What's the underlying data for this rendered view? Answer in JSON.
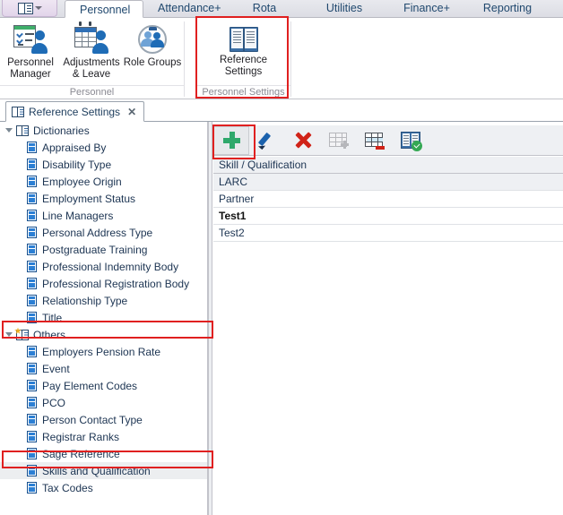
{
  "quick_access": {
    "icon": "book-list-icon",
    "caret": "chevron-down-icon"
  },
  "ribbon": {
    "tabs": [
      {
        "label": "Personnel",
        "active": true
      },
      {
        "label": "Attendance+",
        "active": false
      },
      {
        "label": "Rota",
        "active": false
      },
      {
        "label": "Utilities",
        "active": false
      },
      {
        "label": "Finance+",
        "active": false
      },
      {
        "label": "Reporting",
        "active": false
      }
    ],
    "groups": [
      {
        "name": "Personnel",
        "label": "Personnel",
        "buttons": [
          {
            "label_line1": "Personnel",
            "label_line2": "Manager",
            "icon": "personnel-manager-icon"
          },
          {
            "label_line1": "Adjustments",
            "label_line2": "& Leave",
            "icon": "adjustments-leave-icon"
          },
          {
            "label_line1": "Role Groups",
            "label_line2": "",
            "icon": "role-groups-icon"
          }
        ]
      },
      {
        "name": "Personnel Settings",
        "label": "Personnel Settings",
        "buttons": [
          {
            "label_line1": "Reference",
            "label_line2": "Settings",
            "icon": "reference-settings-icon"
          }
        ]
      }
    ]
  },
  "document_tab": {
    "label": "Reference Settings",
    "icon": "book-icon",
    "close": "✕"
  },
  "tree": {
    "nodes": [
      {
        "label": "Dictionaries",
        "level": 0,
        "icon": "book-icon",
        "expanded": true,
        "selected": false
      },
      {
        "label": "Appraised By",
        "level": 1,
        "icon": "dictionary-item-icon",
        "selected": false
      },
      {
        "label": "Disability Type",
        "level": 1,
        "icon": "dictionary-item-icon",
        "selected": false
      },
      {
        "label": "Employee Origin",
        "level": 1,
        "icon": "dictionary-item-icon",
        "selected": false
      },
      {
        "label": "Employment Status",
        "level": 1,
        "icon": "dictionary-item-icon",
        "selected": false
      },
      {
        "label": "Line Managers",
        "level": 1,
        "icon": "dictionary-item-icon",
        "selected": false
      },
      {
        "label": "Personal Address Type",
        "level": 1,
        "icon": "dictionary-item-icon",
        "selected": false
      },
      {
        "label": "Postgraduate Training",
        "level": 1,
        "icon": "dictionary-item-icon",
        "selected": false
      },
      {
        "label": "Professional Indemnity Body",
        "level": 1,
        "icon": "dictionary-item-icon",
        "selected": false
      },
      {
        "label": "Professional Registration Body",
        "level": 1,
        "icon": "dictionary-item-icon",
        "selected": false
      },
      {
        "label": "Relationship Type",
        "level": 1,
        "icon": "dictionary-item-icon",
        "selected": false
      },
      {
        "label": "Title",
        "level": 1,
        "icon": "dictionary-item-icon",
        "selected": false
      },
      {
        "label": "Others",
        "level": 0,
        "icon": "book-star-icon",
        "expanded": true,
        "selected": false
      },
      {
        "label": "Employers Pension Rate",
        "level": 1,
        "icon": "dictionary-item-icon",
        "selected": false
      },
      {
        "label": "Event",
        "level": 1,
        "icon": "dictionary-item-icon",
        "selected": false
      },
      {
        "label": "Pay Element Codes",
        "level": 1,
        "icon": "dictionary-item-icon",
        "selected": false
      },
      {
        "label": "PCO",
        "level": 1,
        "icon": "dictionary-item-icon",
        "selected": false
      },
      {
        "label": "Person Contact Type",
        "level": 1,
        "icon": "dictionary-item-icon",
        "selected": false
      },
      {
        "label": "Registrar Ranks",
        "level": 1,
        "icon": "dictionary-item-icon",
        "selected": false
      },
      {
        "label": "Sage Reference",
        "level": 1,
        "icon": "dictionary-item-icon",
        "selected": false
      },
      {
        "label": "Skills and Qualification",
        "level": 1,
        "icon": "dictionary-item-icon",
        "selected": true
      },
      {
        "label": "Tax Codes",
        "level": 1,
        "icon": "dictionary-item-icon",
        "selected": false
      }
    ]
  },
  "grid": {
    "toolbar": [
      {
        "name": "add-button",
        "icon": "plus-icon",
        "enabled": true,
        "highlighted": true
      },
      {
        "name": "edit-button",
        "icon": "pencil-icon",
        "enabled": true,
        "highlighted": false
      },
      {
        "name": "delete-button",
        "icon": "red-x-icon",
        "enabled": true,
        "highlighted": false
      },
      {
        "name": "add-row-button",
        "icon": "table-add-row-icon",
        "enabled": false,
        "highlighted": false
      },
      {
        "name": "delete-row-button",
        "icon": "table-delete-row-icon",
        "enabled": true,
        "highlighted": false
      },
      {
        "name": "apply-reference-button",
        "icon": "book-check-icon",
        "enabled": true,
        "highlighted": false
      }
    ],
    "column_header": "Skill / Qualification",
    "rows": [
      {
        "value": "LARC",
        "bold": false,
        "alt": true
      },
      {
        "value": "Partner",
        "bold": false,
        "alt": false
      },
      {
        "value": "Test1",
        "bold": true,
        "alt": false
      },
      {
        "value": "Test2",
        "bold": false,
        "alt": false
      }
    ]
  },
  "annotations": {
    "color": "#e02020",
    "boxes": [
      {
        "name": "reference-settings-highlight"
      },
      {
        "name": "add-button-highlight"
      },
      {
        "name": "others-node-highlight"
      },
      {
        "name": "skills-and-qualification-highlight"
      }
    ]
  }
}
